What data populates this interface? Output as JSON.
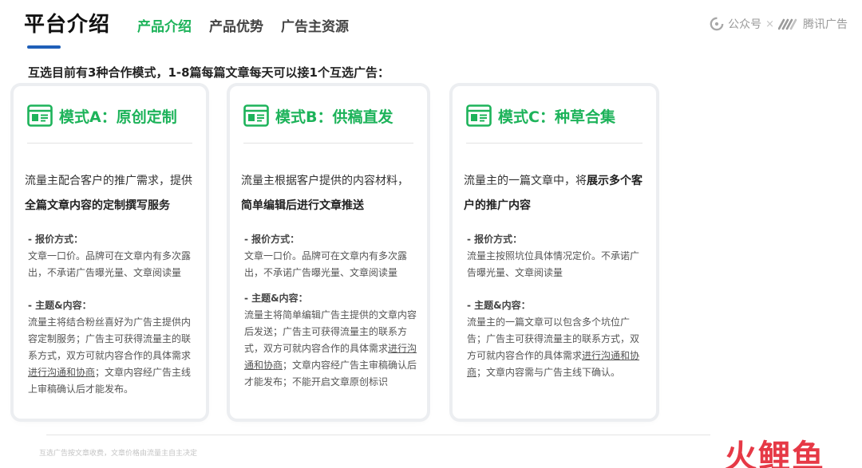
{
  "header": {
    "title": "平台介绍",
    "tabs": [
      {
        "label": "产品介绍",
        "active": true
      },
      {
        "label": "产品优势",
        "active": false
      },
      {
        "label": "广告主资源",
        "active": false
      }
    ],
    "brand": {
      "wechat": "公众号",
      "separator": "×",
      "tencent": "腾讯广告"
    }
  },
  "intro": "互选目前有3种合作模式，1-8篇每篇文章每天可以接1个互选广告：",
  "cards": [
    {
      "title": "模式A：原创定制",
      "desc_plain": "流量主配合客户的推广需求，提供",
      "desc_bold": "全篇文章内容的定制撰写服务",
      "price_label": "- 报价方式：",
      "price_body": "文章一口价。品牌可在文章内有多次露出，不承诺广告曝光量、文章阅读量",
      "content_label": "- 主题&内容：",
      "content_pre": "流量主将结合粉丝喜好为广告主提供内容定制服务；广告主可获得流量主的联系方式，双方可就内容合作的具体需求",
      "content_link": "进行沟通和协商",
      "content_post": "；文章内容经广告主线上审稿确认后才能发布。"
    },
    {
      "title": "模式B：供稿直发",
      "desc_plain": "流量主根据客户提供的内容材料，",
      "desc_bold": "简单编辑后进行文章推送",
      "price_label": "- 报价方式：",
      "price_body": "文章一口价。品牌可在文章内有多次露出，不承诺广告曝光量、文章阅读量",
      "content_label": "- 主题&内容：",
      "content_pre": "流量主将简单编辑广告主提供的文章内容后发送；广告主可获得流量主的联系方式，双方可就内容合作的具体需求",
      "content_link": "进行沟通和协商",
      "content_post": "；文章内容经广告主审稿确认后才能发布；不能开启文章原创标识"
    },
    {
      "title": "模式C：种草合集",
      "desc_plain": "流量主的一篇文章中，将",
      "desc_bold": "展示多个客户的推广内容",
      "price_label": "- 报价方式：",
      "price_body": "流量主按照坑位具体情况定价。不承诺广告曝光量、文章阅读量",
      "content_label": "- 主题&内容：",
      "content_pre": "流量主的一篇文章可以包含多个坑位广告；广告主可获得流量主的联系方式，双方可就内容合作的具体需求",
      "content_link": "进行沟通和协商",
      "content_post": "；文章内容需与广告主线下确认。"
    }
  ],
  "footer": {
    "note": "互选广告按文章收费，文章价格由流量主自主决定",
    "logo": "火鲤鱼"
  },
  "colors": {
    "accent": "#1db35a",
    "title_bar": "#1f5fb8",
    "logo": "#e63946"
  },
  "icons": {
    "card_icon": "browser-window-icon",
    "wechat_icon": "wechat-mini-icon",
    "tencent_icon": "tencent-ads-icon"
  }
}
